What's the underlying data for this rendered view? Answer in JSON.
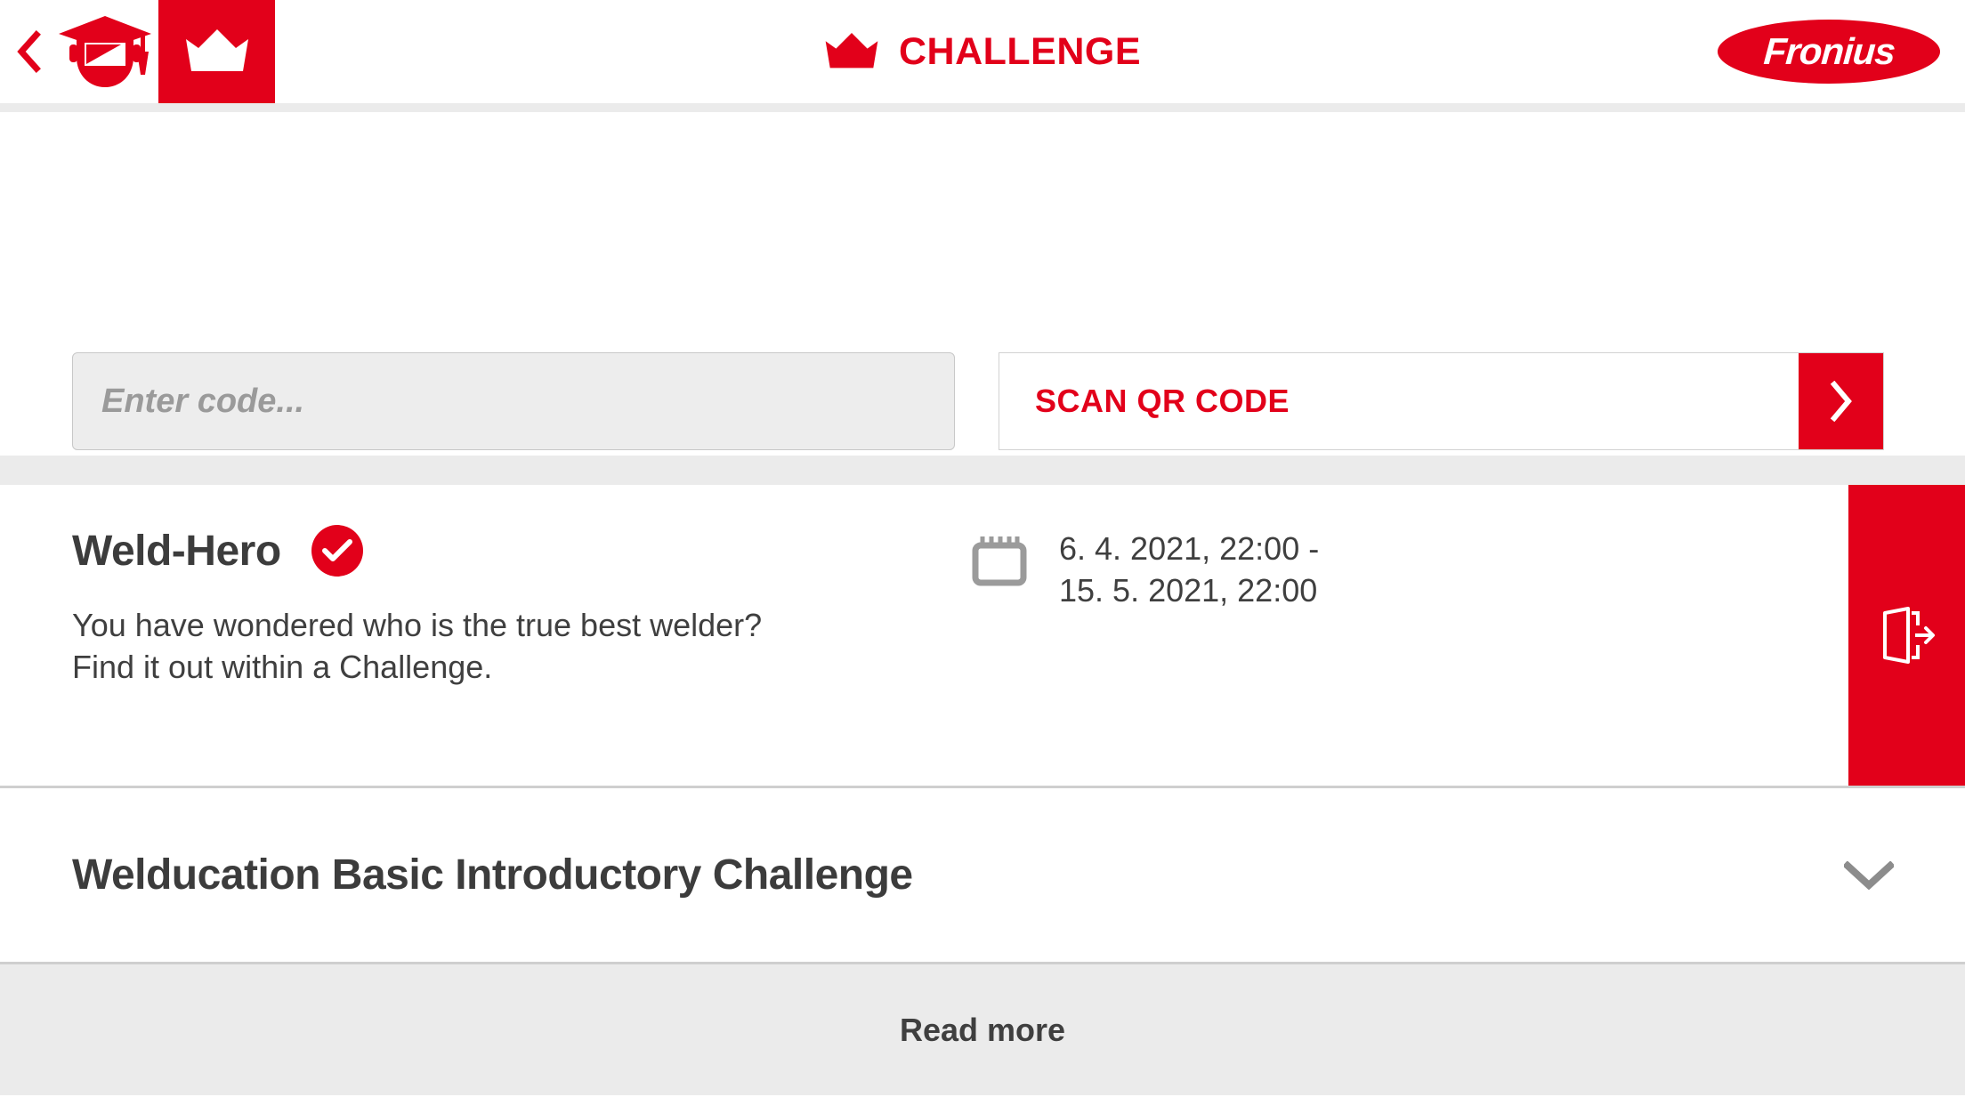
{
  "colors": {
    "brand_red": "#e2001a",
    "band_gray": "#ebebeb",
    "text_dark": "#3c3c3c",
    "placeholder_gray": "#9a9a9a",
    "divider_gray": "#cfcfcf"
  },
  "header": {
    "back_icon": "chevron-left-icon",
    "brand_icon": "welducation-helmet-graduation-logo",
    "crown_tab_icon": "crown-icon",
    "title_icon": "crown-icon",
    "title": "CHALLENGE",
    "company_logo_text": "Fronius"
  },
  "code_section": {
    "input": {
      "value": "",
      "placeholder": "Enter code..."
    },
    "qr_button": {
      "label": "SCAN QR CODE",
      "go_icon": "chevron-right-icon"
    }
  },
  "challenges": [
    {
      "title": "Weld-Hero",
      "status_icon": "check-circle-icon",
      "description_line1": "You have wondered who is the true best welder?",
      "description_line2": "Find it out within a Challenge.",
      "date_icon": "calendar-icon",
      "date_line1": "6. 4. 2021, 22:00 -",
      "date_line2": "15. 5. 2021, 22:00",
      "action_icon": "leave-exit-icon"
    },
    {
      "title": "Welducation Basic Introductory Challenge",
      "expand_icon": "chevron-down-icon"
    }
  ],
  "footer": {
    "read_more_label": "Read more"
  }
}
